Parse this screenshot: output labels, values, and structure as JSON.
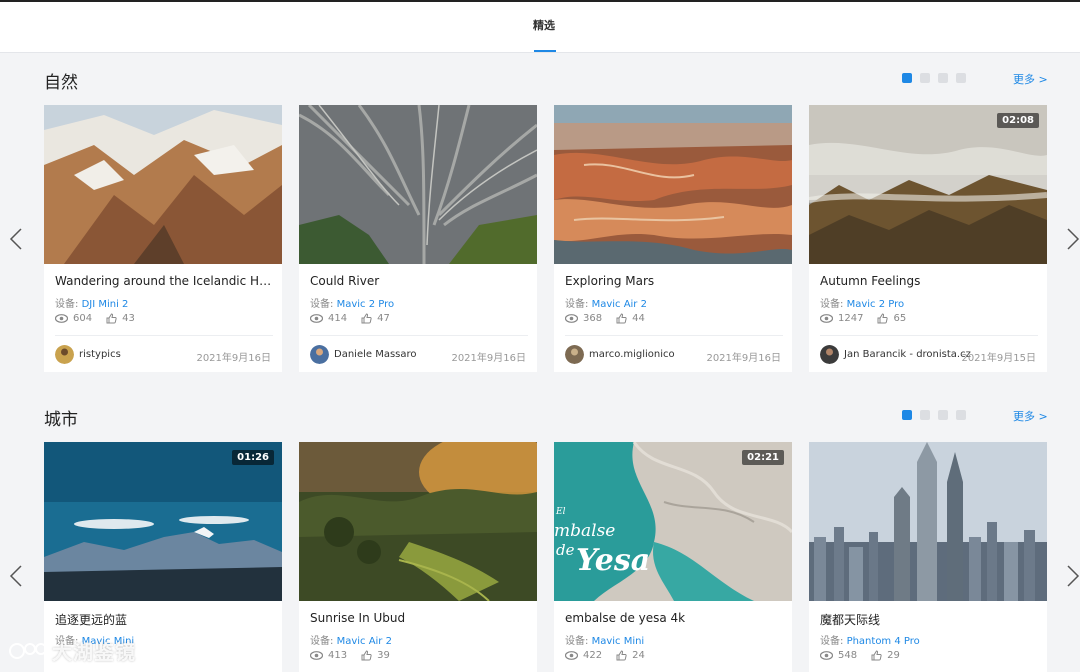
{
  "header": {
    "tab_label": "精选"
  },
  "sections": [
    {
      "title": "自然",
      "more_label": "更多 >",
      "cards": [
        {
          "title": "Wandering around the Icelandic Hig...",
          "device_label": "设备:",
          "device": "DJI Mini 2",
          "views": "604",
          "likes": "43",
          "author": "ristypics",
          "date": "2021年9月16日",
          "duration": ""
        },
        {
          "title": "Could River",
          "device_label": "设备:",
          "device": "Mavic 2 Pro",
          "views": "414",
          "likes": "47",
          "author": "Daniele Massaro",
          "date": "2021年9月16日",
          "duration": ""
        },
        {
          "title": "Exploring Mars",
          "device_label": "设备:",
          "device": "Mavic Air 2",
          "views": "368",
          "likes": "44",
          "author": "marco.miglionico",
          "date": "2021年9月16日",
          "duration": ""
        },
        {
          "title": "Autumn Feelings",
          "device_label": "设备:",
          "device": "Mavic 2 Pro",
          "views": "1247",
          "likes": "65",
          "author": "Jan Barancik - dronista.cz",
          "date": "2021年9月15日",
          "duration": "02:08"
        }
      ]
    },
    {
      "title": "城市",
      "more_label": "更多 >",
      "cards": [
        {
          "title": "追逐更远的蓝",
          "device_label": "设备:",
          "device": "Mavic Mini",
          "views": "",
          "likes": "",
          "duration": "01:26"
        },
        {
          "title": "Sunrise In Ubud",
          "device_label": "设备:",
          "device": "Mavic Air 2",
          "views": "413",
          "likes": "39",
          "duration": ""
        },
        {
          "title": "embalse de yesa 4k",
          "device_label": "设备:",
          "device": "Mavic Mini",
          "views": "422",
          "likes": "24",
          "duration": "02:21",
          "overlay_text": [
            "El",
            "mbalse",
            "de",
            "Yesa"
          ]
        },
        {
          "title": "魔都天际线",
          "device_label": "设备:",
          "device": "Phantom 4 Pro",
          "views": "548",
          "likes": "29",
          "duration": ""
        }
      ]
    }
  ],
  "watermark": "大湖鉴镜",
  "icons": {
    "prev": "chevron-left-icon",
    "next": "chevron-right-icon",
    "views": "eye-icon",
    "likes": "thumbs-up-icon"
  },
  "colors": {
    "accent": "#1e88e5",
    "background": "#f3f4f6"
  }
}
